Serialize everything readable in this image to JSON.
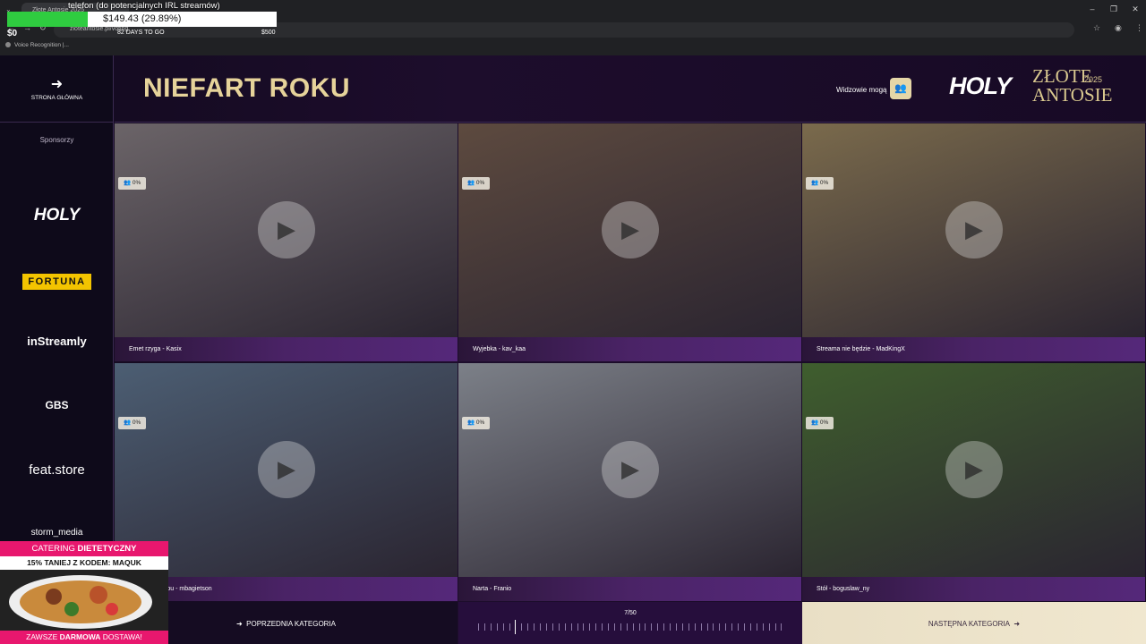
{
  "browser": {
    "tab_title": "Złote Antosie 2025",
    "url": "zloteantosie.pl/voting",
    "bookmark": "Voice Recognition |..."
  },
  "stream_overlay": {
    "title": "telefon (do potencjalnych IRL streamów)",
    "donation_amount": "$149.43 (29.89%)",
    "donation_progress": 0.2989,
    "goal_start": "$0",
    "days_left": "82 DAYS TO GO",
    "goal_end": "$500"
  },
  "sidebar": {
    "back_label": "STRONA GŁÓWNA",
    "sponsors_label": "Sponsorzy",
    "sponsors": [
      "HOLY",
      "FORTUNA",
      "inStreamly",
      "GBS",
      "feat.store",
      "storm_media"
    ]
  },
  "header": {
    "title": "NIEFART ROKU",
    "viewers_label": "Widzowie mogą",
    "brand_holy": "HOLY",
    "brand_zlote": "ZŁOTE",
    "brand_antosie": "ANTOSIE",
    "brand_year": "2025"
  },
  "tiles": [
    {
      "caption": "Emet rzyga - Kasix",
      "percent": "0%",
      "bg": "#6b6468"
    },
    {
      "caption": "Wyjebka - kav_kaa",
      "percent": "0%",
      "bg": "#5d4a3f"
    },
    {
      "caption": "Streama nie będzie - MadKingX",
      "percent": "0%",
      "bg": "#7a6a4c"
    },
    {
      "caption": "erdala ze stropu - mbagietson",
      "percent": "0%",
      "bg": "#4c5e73"
    },
    {
      "caption": "Narta - Franio",
      "percent": "0%",
      "bg": "#7c8088"
    },
    {
      "caption": "Stół - boguslaw_ny",
      "percent": "0%",
      "bg": "#3f5e2e"
    }
  ],
  "footer": {
    "prev_label": "POPRZEDNIA KATEGORIA",
    "page_indicator": "7/50",
    "next_label": "NASTĘPNA KATEGORIA"
  },
  "promo": {
    "line1_a": "CATERING ",
    "line1_b": "DIETETYCZNY",
    "line2": "15% TANIEJ Z KODEM: MAQUK",
    "line3_a": "ZAWSZE ",
    "line3_b": "DARMOWA",
    "line3_c": " DOSTAWA!"
  },
  "colors": {
    "accent_gold": "#e6d39a",
    "purple": "#4a2366",
    "pink": "#e8176e",
    "progress_green": "#2fcc40"
  }
}
